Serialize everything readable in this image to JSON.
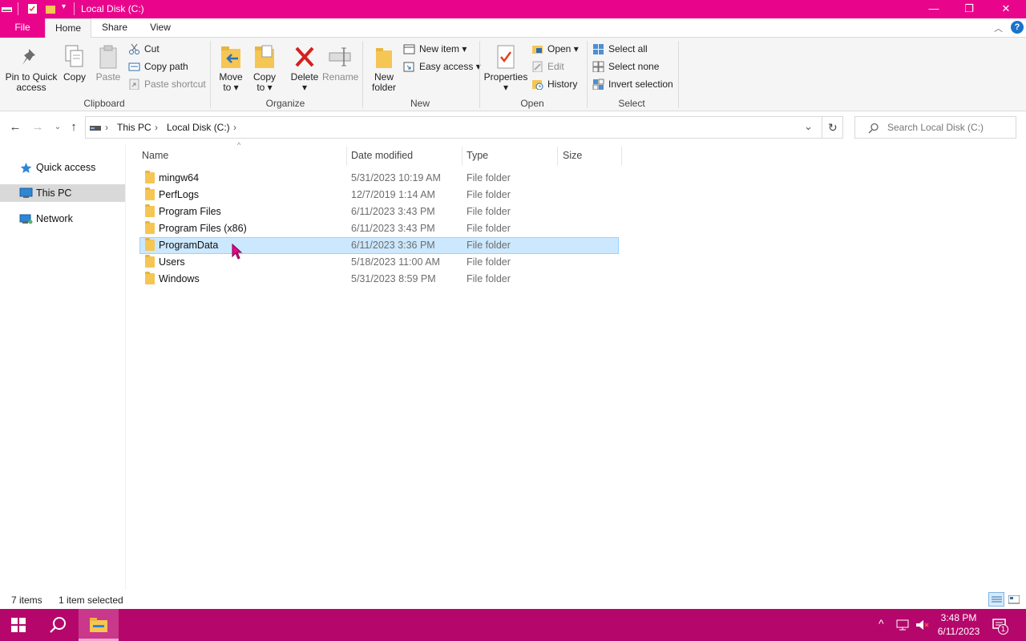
{
  "window": {
    "title": "Local Disk (C:)"
  },
  "window_controls": {
    "minimize": "—",
    "maximize": "❐",
    "close": "✕"
  },
  "tabs": {
    "file": "File",
    "home": "Home",
    "share": "Share",
    "view": "View"
  },
  "ribbon": {
    "clipboard": {
      "label": "Clipboard",
      "pin_line1": "Pin to Quick",
      "pin_line2": "access",
      "copy": "Copy",
      "paste": "Paste",
      "cut": "Cut",
      "copy_path": "Copy path",
      "paste_shortcut": "Paste shortcut"
    },
    "organize": {
      "label": "Organize",
      "move_line1": "Move",
      "move_line2": "to ▾",
      "copy_line1": "Copy",
      "copy_line2": "to ▾",
      "delete": "Delete",
      "delete_arrow": "▾",
      "rename": "Rename"
    },
    "new": {
      "label": "New",
      "folder_line1": "New",
      "folder_line2": "folder",
      "new_item": "New item ▾",
      "easy_access": "Easy access ▾"
    },
    "open": {
      "label": "Open",
      "properties": "Properties",
      "properties_arrow": "▾",
      "open": "Open ▾",
      "edit": "Edit",
      "history": "History"
    },
    "select": {
      "label": "Select",
      "select_all": "Select all",
      "select_none": "Select none",
      "invert": "Invert selection"
    }
  },
  "address": {
    "segments": [
      "This PC",
      "Local Disk (C:)"
    ],
    "search_placeholder": "Search Local Disk (C:)"
  },
  "nav": {
    "items": [
      {
        "label": "Quick access"
      },
      {
        "label": "This PC"
      },
      {
        "label": "Network"
      }
    ]
  },
  "columns": {
    "name": "Name",
    "date": "Date modified",
    "type": "Type",
    "size": "Size"
  },
  "files": [
    {
      "name": "mingw64",
      "date": "5/31/2023 10:19 AM",
      "type": "File folder"
    },
    {
      "name": "PerfLogs",
      "date": "12/7/2019 1:14 AM",
      "type": "File folder"
    },
    {
      "name": "Program Files",
      "date": "6/11/2023 3:43 PM",
      "type": "File folder"
    },
    {
      "name": "Program Files (x86)",
      "date": "6/11/2023 3:43 PM",
      "type": "File folder"
    },
    {
      "name": "ProgramData",
      "date": "6/11/2023 3:36 PM",
      "type": "File folder"
    },
    {
      "name": "Users",
      "date": "5/18/2023 11:00 AM",
      "type": "File folder"
    },
    {
      "name": "Windows",
      "date": "5/31/2023 8:59 PM",
      "type": "File folder"
    }
  ],
  "status": {
    "count": "7 items",
    "selected": "1 item selected"
  },
  "taskbar": {
    "time": "3:48 PM",
    "date": "6/11/2023",
    "notifications": "1"
  },
  "colors": {
    "accent": "#e9058b",
    "taskbar": "#b5076b",
    "selection": "#cce8ff"
  }
}
